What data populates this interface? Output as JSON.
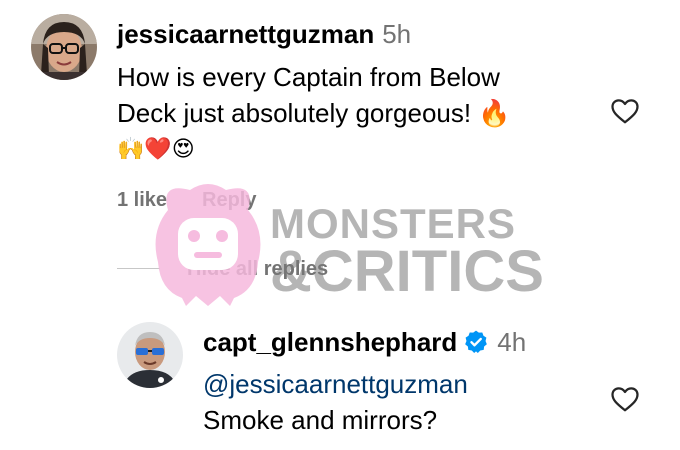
{
  "comment1": {
    "username": "jessicaarnettguzman",
    "time": "5h",
    "text_line1": "How is every Captain from Below",
    "text_line2": "Deck just absolutely gorgeous! 🔥",
    "text_line3": "🙌❤️😍",
    "likes": "1 like",
    "reply_label": "Reply",
    "hide_replies_label": "Hide all replies"
  },
  "comment2": {
    "username": "capt_glennshephard",
    "time": "4h",
    "mention": "@jessicaarnettguzman",
    "text": "Smoke and mirrors?"
  },
  "watermark": {
    "line1": "MONSTERS",
    "line2": "&CRITICS"
  },
  "colors": {
    "secondary_text": "#737373",
    "mention": "#00376b",
    "verified": "#0095f6",
    "watermark_pink": "#f6b8dd"
  },
  "icons": {
    "like": "heart-outline-icon",
    "verified": "verified-badge-icon"
  }
}
